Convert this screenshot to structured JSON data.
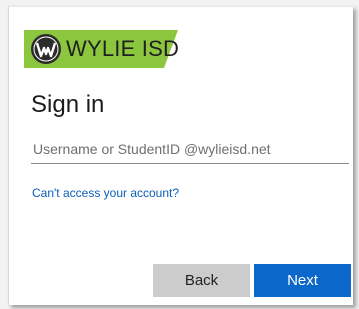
{
  "brand": {
    "name": "WYLIE ISD",
    "emblem_letter": "W",
    "banner_color": "#8cc63f",
    "emblem_color": "#2b2b2b"
  },
  "signin": {
    "title": "Sign in",
    "username_placeholder": "Username or StudentID @wylieisd.net",
    "username_value": "",
    "help_link": "Can't access your account?"
  },
  "buttons": {
    "back_label": "Back",
    "next_label": "Next",
    "primary_color": "#0b67c9",
    "secondary_color": "#cccccc"
  }
}
